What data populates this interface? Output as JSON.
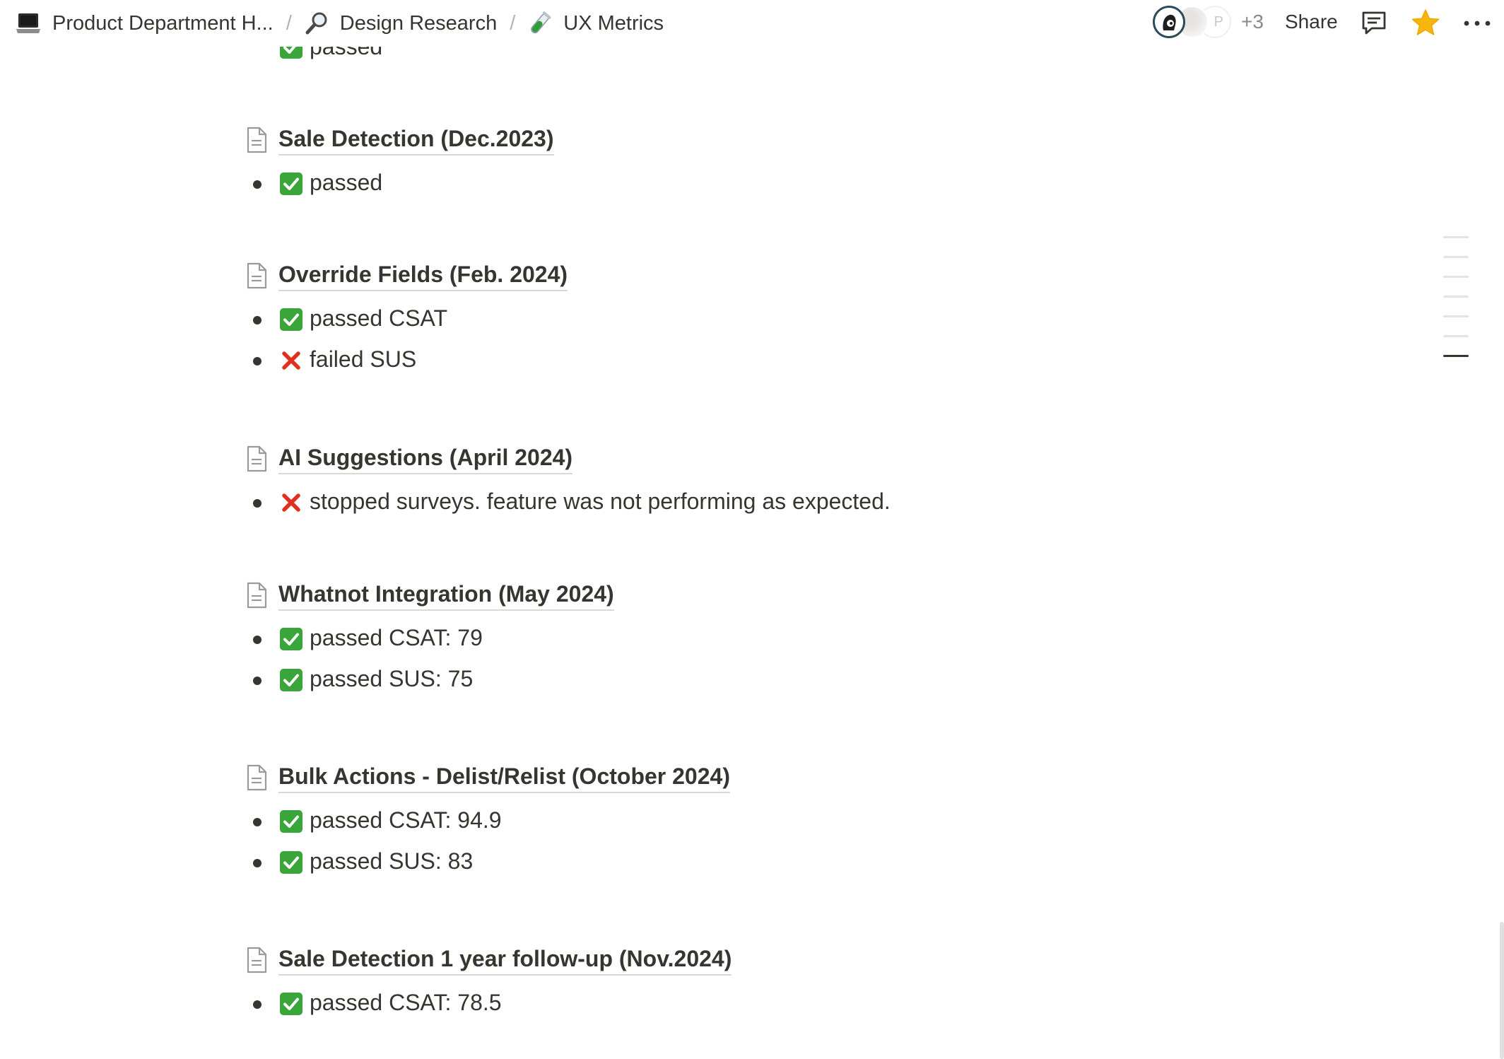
{
  "breadcrumbs": [
    {
      "label": "Product Department H...",
      "icon": "laptop-icon"
    },
    {
      "label": "Design Research",
      "icon": "magnifier-icon"
    },
    {
      "label": "UX Metrics",
      "icon": "test-tube-icon"
    }
  ],
  "breadcrumb_separator": "/",
  "header": {
    "avatar_initial": "P",
    "extra_collaborators": "+3",
    "share_label": "Share",
    "star_color": "#f5b60d"
  },
  "partial_item": {
    "label": "passed"
  },
  "sections": [
    {
      "title": "Sale Detection (Dec.2023)",
      "items": [
        {
          "status": "check",
          "text": "passed"
        }
      ]
    },
    {
      "title": "Override Fields (Feb. 2024)",
      "items": [
        {
          "status": "check",
          "text": "passed CSAT"
        },
        {
          "status": "cross",
          "text": "failed SUS"
        }
      ]
    },
    {
      "title": "AI Suggestions (April 2024)",
      "items": [
        {
          "status": "cross",
          "text": "stopped surveys. feature was not performing as expected."
        }
      ]
    },
    {
      "title": "Whatnot Integration (May 2024)",
      "items": [
        {
          "status": "check",
          "text": "passed CSAT: 79"
        },
        {
          "status": "check",
          "text": "passed SUS: 75"
        }
      ]
    },
    {
      "title": "Bulk Actions - Delist/Relist (October 2024)",
      "items": [
        {
          "status": "check",
          "text": "passed CSAT: 94.9"
        },
        {
          "status": "check",
          "text": "passed SUS: 83"
        }
      ]
    },
    {
      "title": "Sale Detection 1 year follow-up (Nov.2024)",
      "items": [
        {
          "status": "check",
          "text": "passed CSAT: 78.5"
        }
      ]
    }
  ],
  "colors": {
    "check": "#3aa53a",
    "cross": "#e0301e",
    "text": "#37352f"
  }
}
